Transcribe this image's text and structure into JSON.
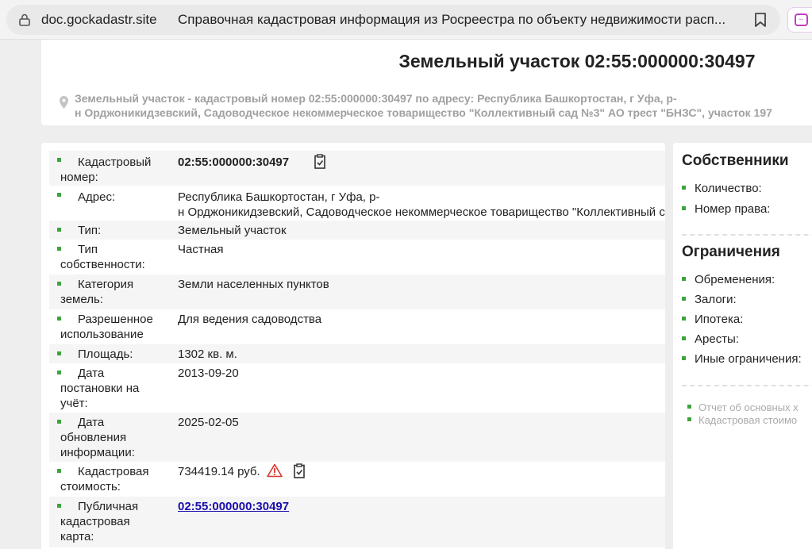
{
  "browser": {
    "domain": "doc.gockadastr.site",
    "title": "Справочная кадастровая информация из Росреестра по объекту недвижимости расп..."
  },
  "header": {
    "title": "Земельный участок 02:55:000000:30497",
    "address_line1": "Земельный участок - кадастровый номер 02:55:000000:30497 по адресу: Республика Башкортостан, г Уфа, р-",
    "address_line2": "н Орджоникидзевский, Садоводческое некоммерческое товарищество \"Коллективный сад №3\" АО трест \"БНЗС\", участок 197"
  },
  "details": {
    "cadastral_label": [
      "Кадастровый",
      "номер:"
    ],
    "cadastral_value": "02:55:000000:30497",
    "address_label": "Адрес:",
    "address_value1": "Республика Башкортостан, г Уфа, р-",
    "address_value2": "н Орджоникидзевский, Садоводческое некоммерческое товарищество \"Коллективный сад",
    "type_label": "Тип:",
    "type_value": "Земельный участок",
    "ownership_label": [
      "Тип",
      "собственности:"
    ],
    "ownership_value": "Частная",
    "category_label": [
      "Категория",
      "земель:"
    ],
    "category_value": "Земли населенных пунктов",
    "permitted_label": [
      "Разрешенное",
      "использование"
    ],
    "permitted_value": "Для ведения садоводства",
    "area_label": "Площадь:",
    "area_value": "1302 кв. м.",
    "reg_date_label": [
      "Дата",
      "постановки на",
      "учёт:"
    ],
    "reg_date_value": "2013-09-20",
    "upd_date_label": [
      "Дата",
      "обновления",
      "информации:"
    ],
    "upd_date_value": "2025-02-05",
    "cost_label": [
      "Кадастровая",
      "стоимость:"
    ],
    "cost_value": "734419.14 руб.",
    "map_label": [
      "Публичная",
      "кадастровая",
      "карта:"
    ],
    "map_value": "02:55:000000:30497"
  },
  "owners": {
    "title": "Собственники",
    "count_label": "Количество:",
    "right_label": "Номер права:"
  },
  "restrictions": {
    "title": "Ограничения",
    "items": [
      "Обременения:",
      "Залоги:",
      "Ипотека:",
      "Аресты:",
      "Иные ограничения:"
    ]
  },
  "reports": {
    "items": [
      "Отчет об основных х",
      "Кадастровая стоимо"
    ]
  },
  "colors": {
    "bullet": "#3fa33f",
    "link": "#1a0dab",
    "warning": "#d9342b"
  }
}
